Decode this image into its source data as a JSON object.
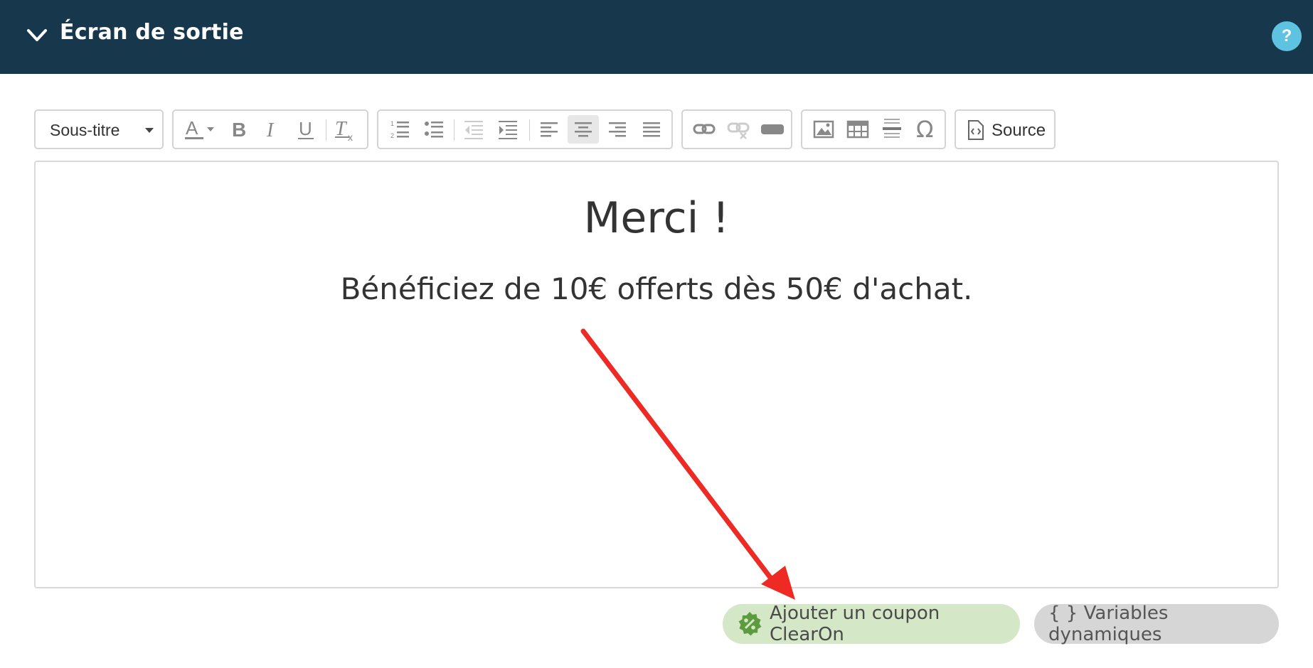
{
  "header": {
    "title": "Écran de sortie",
    "help_label": "?",
    "color": "#17384c",
    "help_color": "#5ec3e0"
  },
  "toolbar": {
    "style_select": {
      "value": "Sous-titre"
    },
    "source_label": "Source",
    "icons": [
      "text-color",
      "bold",
      "italic",
      "underline",
      "remove-format",
      "numbered-list",
      "bulleted-list",
      "outdent",
      "indent",
      "align-left",
      "align-center",
      "align-right",
      "justify",
      "link",
      "unlink",
      "anchor",
      "image",
      "table",
      "horizontal-rule",
      "special-character",
      "source"
    ]
  },
  "editor": {
    "heading": "Merci !",
    "paragraph": "Bénéficiez de 10€ offerts dès 50€ d'achat."
  },
  "actions": {
    "coupon_label": "Ajouter un coupon ClearOn",
    "variables_label": "{ } Variables dynamiques",
    "coupon_color": "#d4e7c6",
    "coupon_icon_color": "#5d9b3f"
  },
  "annotation": {
    "arrow_color": "#ee2a24"
  }
}
